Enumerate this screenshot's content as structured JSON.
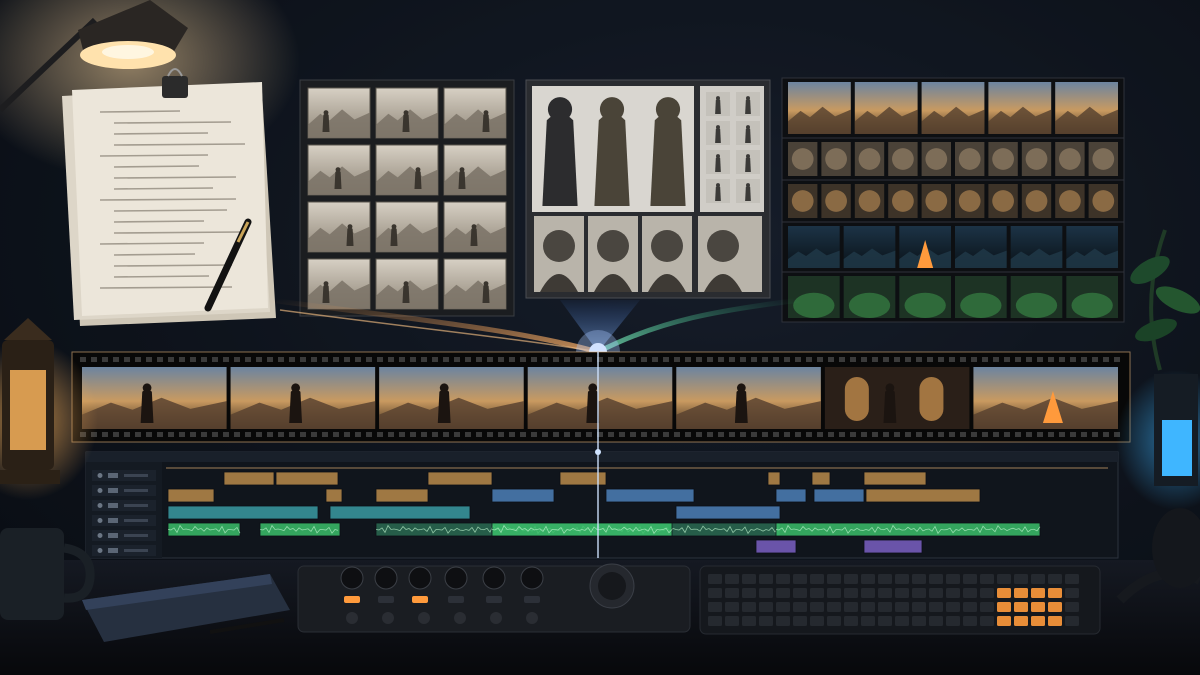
{
  "scene": {
    "colors": {
      "wall": "#121823",
      "desk": "#0b0e14",
      "lamp_glow": "#f3c27a",
      "storyboard_beam": "#e8934a",
      "character_beam": "#4a8dff",
      "environment_beam": "#3bcf8e",
      "film_frame": "#0a0a0a",
      "playhead": "#cfe3ff",
      "clip_gold": "#b88a4a",
      "clip_blue": "#4d7fb8",
      "clip_teal": "#3a9aa2",
      "clip_green": "#3bbf6a",
      "clip_purple": "#7a5fc2",
      "button_orange": "#ff9a3c",
      "cube_blue": "#2fa8ff"
    },
    "timeline": {
      "track_count": 6
    },
    "storyboard": {
      "rows": 4,
      "cols": 3
    },
    "asset_strips": {
      "rows": 5
    },
    "filmstrip": {
      "frames": 7
    },
    "icons": [
      "desk-lamp-icon",
      "binder-clip-icon",
      "pen-icon",
      "lantern-icon",
      "mug-icon",
      "plant-icon",
      "headphones-icon"
    ]
  }
}
